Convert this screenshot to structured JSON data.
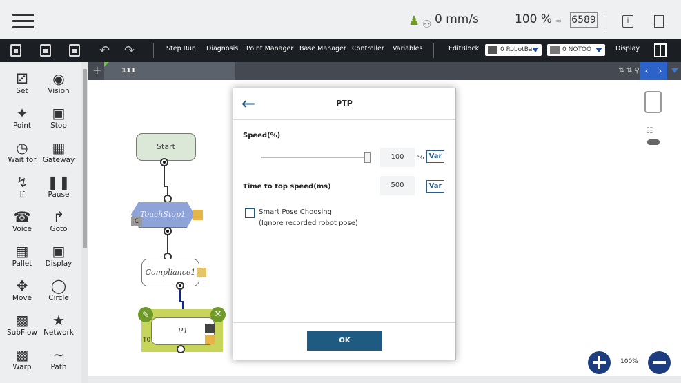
{
  "topbar": {
    "speed": "0 mm/s",
    "percent": "100 %",
    "counter": "6589"
  },
  "toolbar": {
    "buttons": [
      "Step Run",
      "Diagnosis",
      "Point Manager",
      "Base Manager",
      "Controller",
      "Variables",
      "EditBlock"
    ],
    "robot_base": "0 RobotBa",
    "tool": "0 NOTOO",
    "display": "Display"
  },
  "tools": [
    {
      "label": "Set",
      "icon": "set-icon"
    },
    {
      "label": "Vision",
      "icon": "vision-icon"
    },
    {
      "label": "Point",
      "icon": "point-icon"
    },
    {
      "label": "Stop",
      "icon": "stop-icon"
    },
    {
      "label": "Wait for",
      "icon": "wait-icon"
    },
    {
      "label": "Gateway",
      "icon": "gateway-icon"
    },
    {
      "label": "If",
      "icon": "if-icon"
    },
    {
      "label": "Pause",
      "icon": "pause-icon"
    },
    {
      "label": "Voice",
      "icon": "voice-icon"
    },
    {
      "label": "Goto",
      "icon": "goto-icon"
    },
    {
      "label": "Pallet",
      "icon": "pallet-icon"
    },
    {
      "label": "Display",
      "icon": "display-icon"
    },
    {
      "label": "Move",
      "icon": "move-icon"
    },
    {
      "label": "Circle",
      "icon": "circle-icon"
    },
    {
      "label": "SubFlow",
      "icon": "subflow-icon"
    },
    {
      "label": "Network",
      "icon": "network-icon"
    },
    {
      "label": "Warp",
      "icon": "warp-icon"
    },
    {
      "label": "Path",
      "icon": "path-icon"
    }
  ],
  "canvas": {
    "tab_name": "111",
    "zoom": "100%",
    "nodes": {
      "start": "Start",
      "touchstop": "TouchStop1",
      "touchstop_badge": "C",
      "compliance": "Compliance1",
      "p1": "P1",
      "p1_tag": "T0"
    }
  },
  "dialog": {
    "title": "PTP",
    "speed_label": "Speed(%)",
    "speed_value": "100",
    "speed_unit": "%",
    "var_label": "Var",
    "time_label": "Time to top speed(ms)",
    "time_value": "500",
    "smart_pose": "Smart Pose Choosing",
    "smart_pose_note": "(Ignore recorded robot pose)",
    "ok": "OK",
    "speed_level_percent": 100
  },
  "colors": {
    "accent": "#1f5a82",
    "toolbar": "#1b1f23",
    "node_start": "#dbe8d8",
    "node_touchstop": "#8ea3d8",
    "node_p1_frame": "#c7d65a",
    "zoom_button": "#1d3d7e"
  }
}
